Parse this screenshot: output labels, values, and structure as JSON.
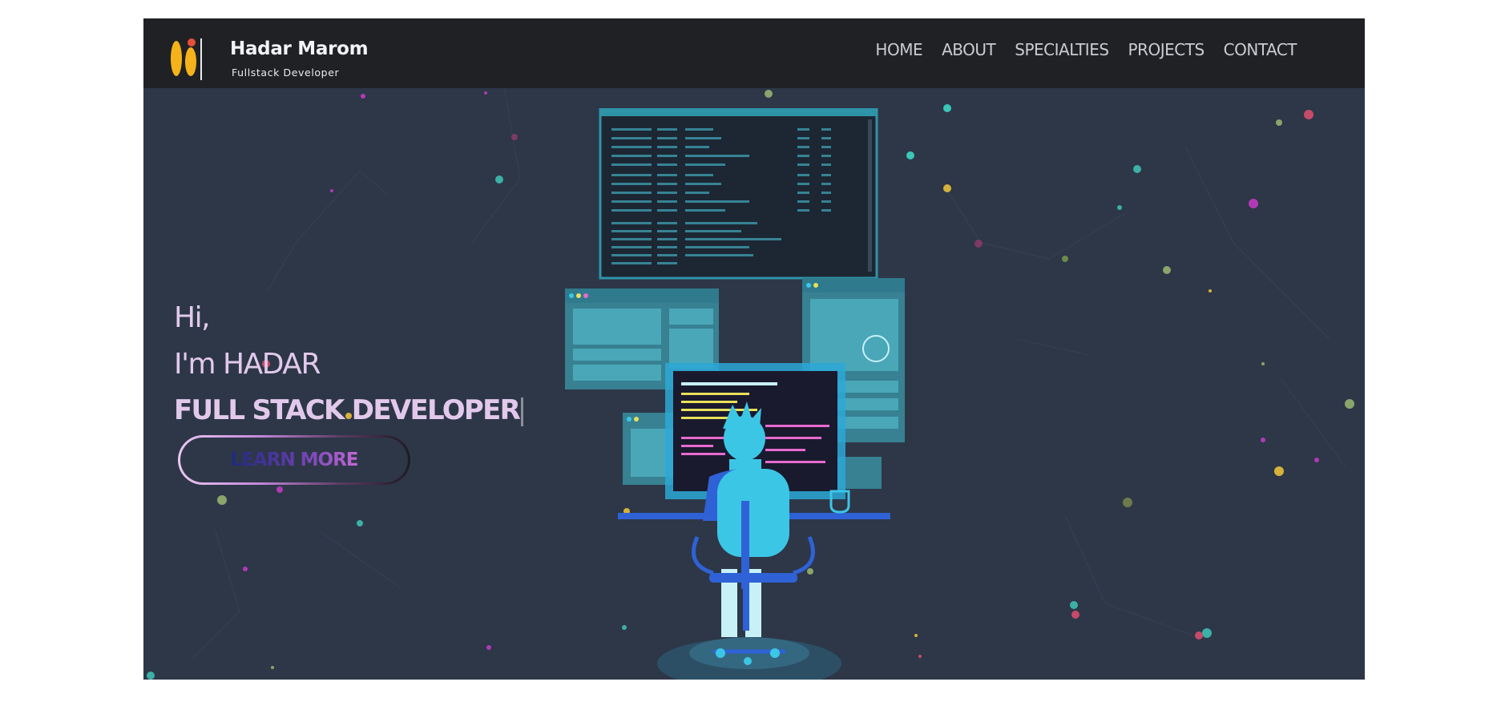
{
  "header": {
    "logo": {
      "name": "Hadar Marom",
      "tagline": "Fullstack Developer"
    },
    "nav": [
      {
        "label": "HOME"
      },
      {
        "label": "ABOUT"
      },
      {
        "label": "SPECIALTIES"
      },
      {
        "label": "PROJECTS"
      },
      {
        "label": "CONTACT"
      }
    ]
  },
  "hero": {
    "greeting": "Hi,",
    "intro": "I'm HADAR",
    "role": "FULL STACK DEVELOPER",
    "cta_label": "LEARN MORE"
  },
  "colors": {
    "navbar_bg": "#202124",
    "hero_bg": "#2d3748",
    "hero_text": "#e2c9ec",
    "nav_text": "#c9ccd1",
    "accent_cyan": "#3cc6e6",
    "logo_yellow": "#f5b21a",
    "logo_red": "#e8503a"
  },
  "icons": {
    "logo_mark": "hm-logo-icon"
  }
}
